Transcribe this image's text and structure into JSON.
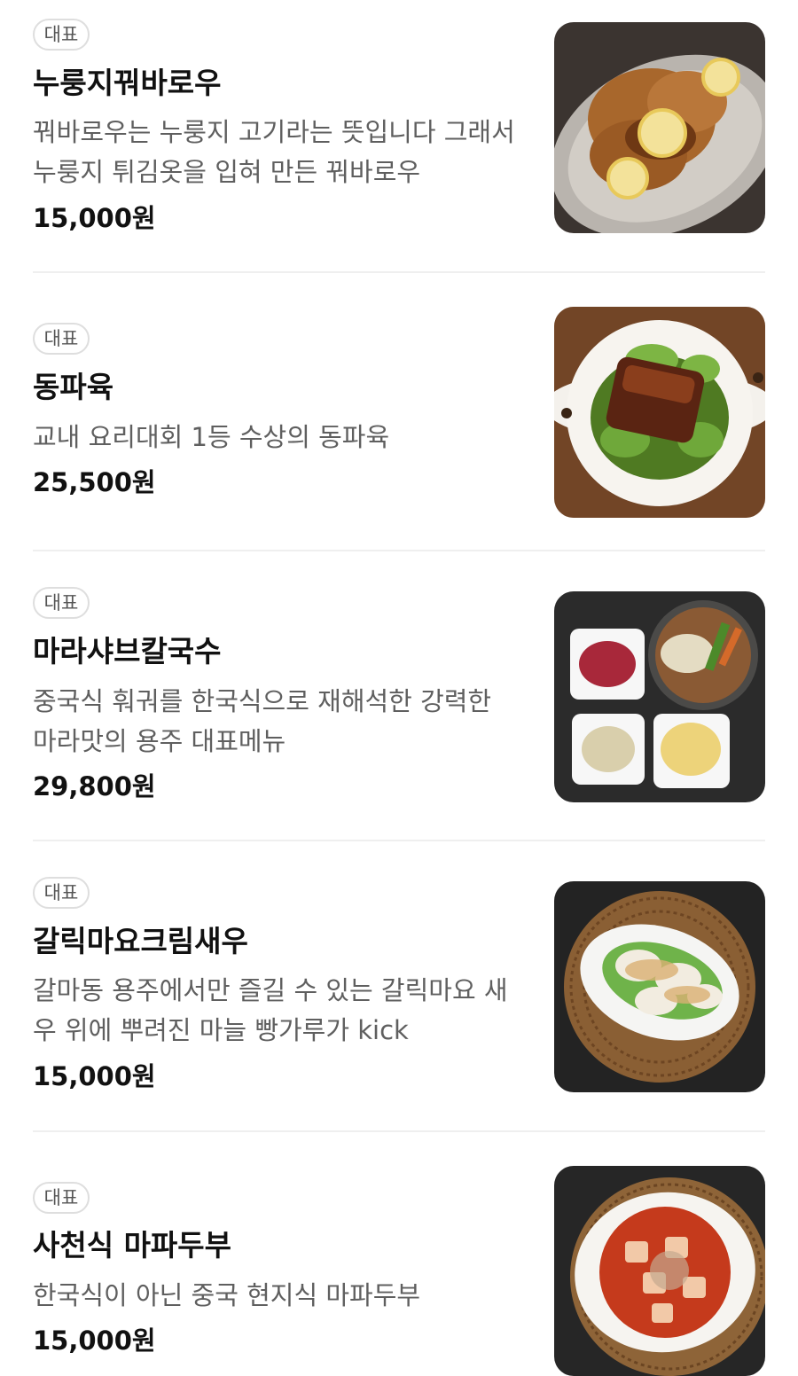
{
  "menu": {
    "items": [
      {
        "badge": "대표",
        "name": "누룽지꿔바로우",
        "description": "꿔바로우는 누룽지 고기라는 뜻입니다 그래서 누룽지 튀김옷을 입혀 만든 꿔바로우",
        "price": "15,000원",
        "image_icon": "fried-pork-dish-photo"
      },
      {
        "badge": "대표",
        "name": "동파육",
        "description": "교내 요리대회 1등 수상의 동파육",
        "price": "25,500원",
        "image_icon": "braised-pork-belly-photo"
      },
      {
        "badge": "대표",
        "name": "마라샤브칼국수",
        "description": "중국식 훠궈를 한국식으로 재해석한 강력한 마라맛의 용주 대표메뉴",
        "price": "29,800원",
        "image_icon": "mala-hotpot-set-photo"
      },
      {
        "badge": "대표",
        "name": "갈릭마요크림새우",
        "description": "갈마동 용주에서만 즐길 수 있는 갈릭마요 새우 위에 뿌려진 마늘 빵가루가 kick",
        "price": "15,000원",
        "image_icon": "garlic-mayo-shrimp-photo"
      },
      {
        "badge": "대표",
        "name": "사천식 마파두부",
        "description": "한국식이 아닌 중국 현지식 마파두부",
        "price": "15,000원",
        "image_icon": "mapo-tofu-photo"
      }
    ]
  }
}
